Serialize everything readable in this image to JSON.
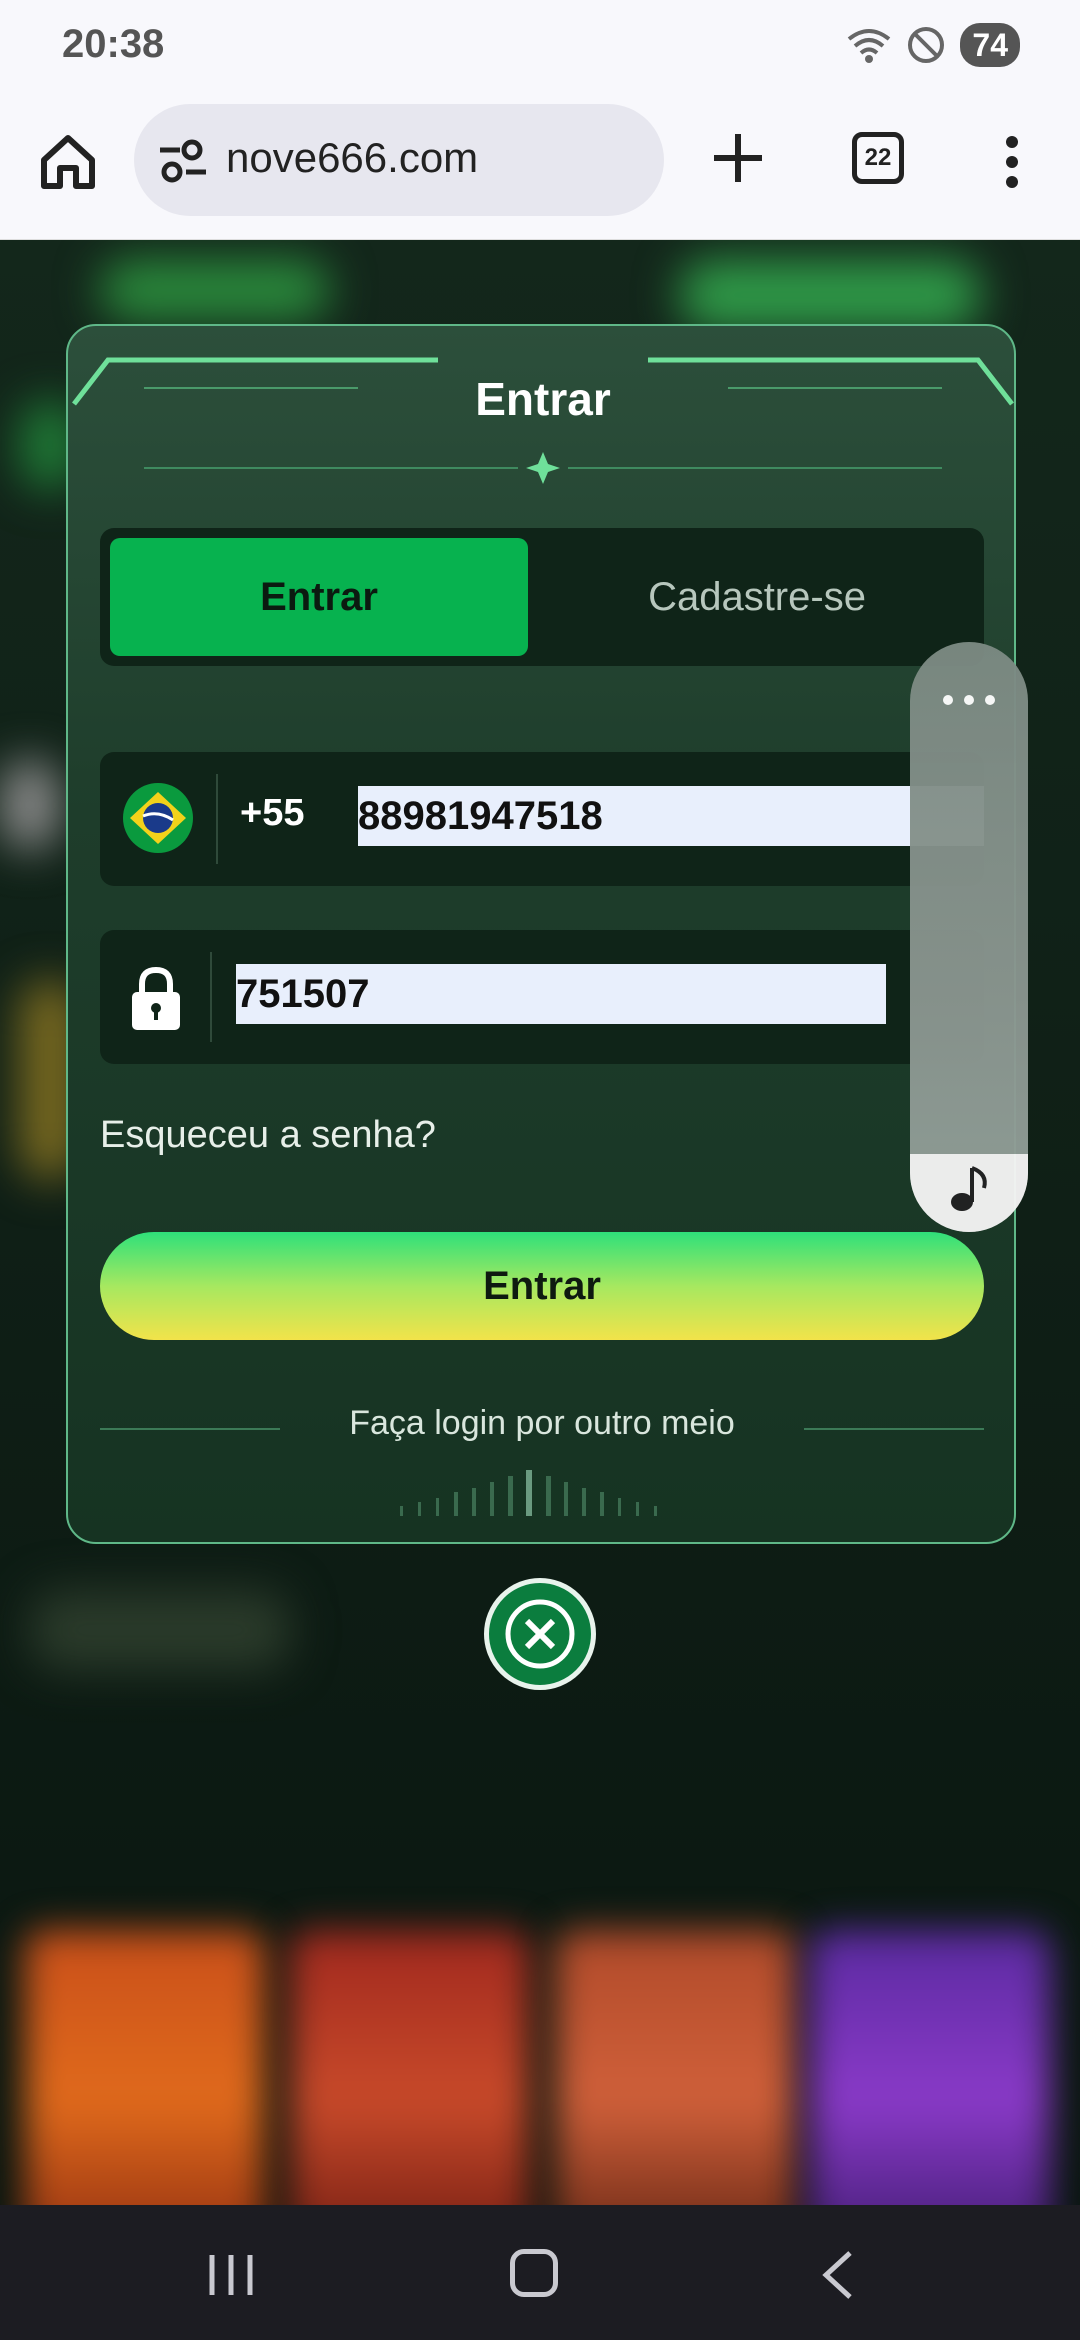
{
  "status_bar": {
    "time": "20:38",
    "battery": "74",
    "icons": [
      "wifi-icon",
      "do-not-disturb-icon",
      "battery-icon"
    ]
  },
  "browser": {
    "url": "nove666.com",
    "tab_count": "22",
    "icons": [
      "home-icon",
      "site-settings-icon",
      "new-tab-icon",
      "tabs-icon",
      "more-menu-icon"
    ]
  },
  "login_modal": {
    "title": "Entrar",
    "tabs": [
      {
        "label": "Entrar",
        "active": true
      },
      {
        "label": "Cadastre-se",
        "active": false
      }
    ],
    "phone": {
      "country_code": "+55",
      "value": "88981947518",
      "flag": "brazil-flag-icon"
    },
    "password": {
      "value": "751507",
      "icon": "lock-icon"
    },
    "forgot_password": "Esqueceu a senha?",
    "submit_label": "Entrar",
    "alt_login_text": "Faça login por outro meio",
    "colors": {
      "accent_green": "#07b24f",
      "border": "#5fb888",
      "button_gradient_top": "#2fe07a",
      "button_gradient_bottom": "#f2e34a"
    }
  },
  "close_button": {
    "icon": "close-icon"
  },
  "side_panel": {
    "icons": [
      "more-dots-icon",
      "music-note-icon"
    ]
  },
  "nav_bar": {
    "icons": [
      "recents-icon",
      "home-icon",
      "back-icon"
    ]
  }
}
